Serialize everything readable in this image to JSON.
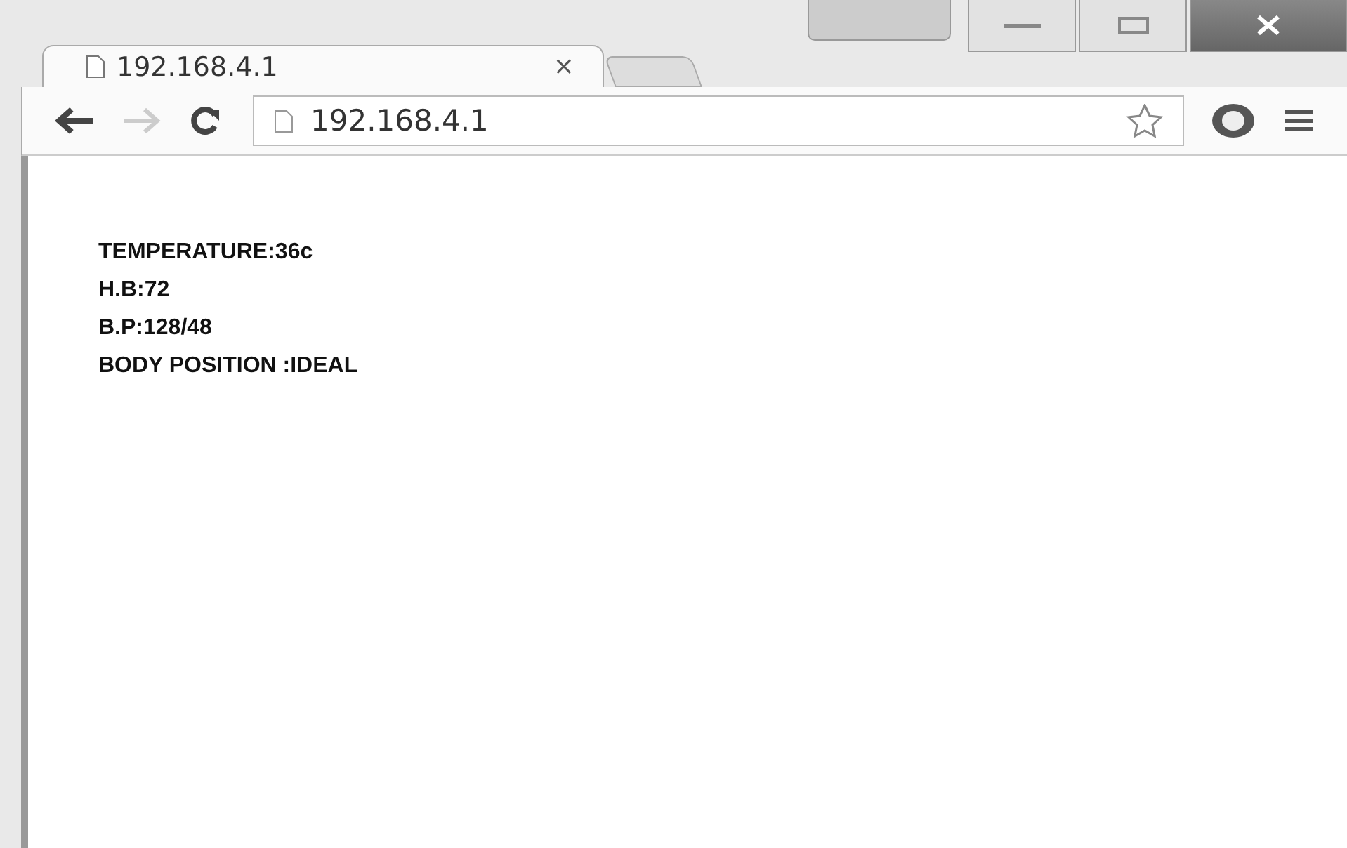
{
  "tabs": [
    {
      "title": "192.168.4.1",
      "close": "×",
      "selected": true
    }
  ],
  "address_bar": {
    "value": "192.168.4.1"
  },
  "page": {
    "lines": [
      "TEMPERATURE:36c",
      "H.B:72",
      "B.P:128/48",
      "BODY POSITION :IDEAL"
    ]
  }
}
